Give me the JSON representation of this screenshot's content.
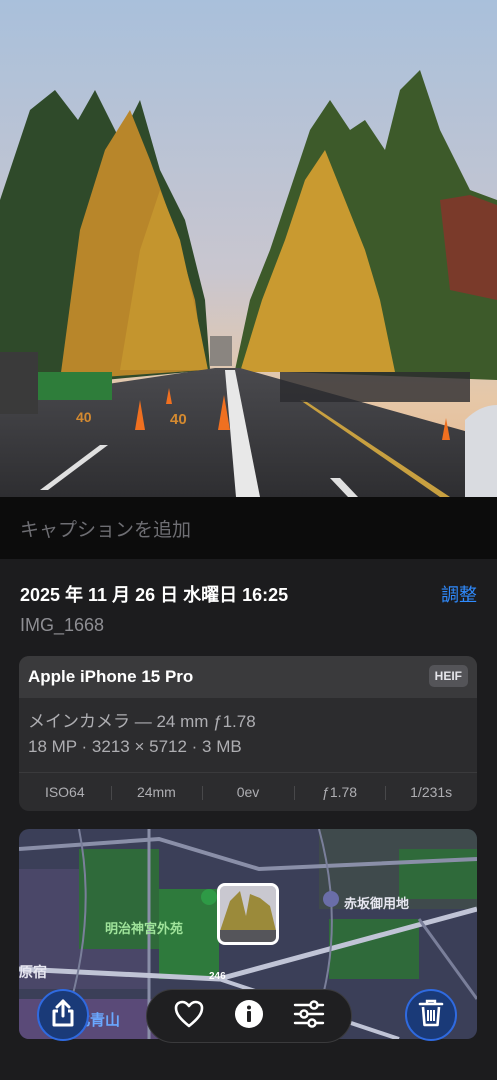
{
  "caption": {
    "placeholder": "キャプションを追加"
  },
  "info": {
    "date": "2025 年 11 月 26 日 水曜日 16:25",
    "adjust_label": "調整",
    "filename": "IMG_1668"
  },
  "camera": {
    "device": "Apple iPhone 15 Pro",
    "format_badge": "HEIF",
    "lens": "メインカメラ — 24 mm ƒ1.78",
    "specs": "18 MP · 3213 × 5712 · 3 MB",
    "exif": [
      "ISO64",
      "24mm",
      "0ev",
      "ƒ1.78",
      "1/231s"
    ]
  },
  "map": {
    "labels": {
      "shrine": "明治神宮外苑",
      "palace": "赤坂御用地",
      "harajuku": "原宿",
      "aoyama": "北青山",
      "road": "246"
    }
  },
  "toolbar": {
    "share_icon": "share-icon",
    "favorite_icon": "heart-icon",
    "info_icon": "info-icon",
    "adjust_icon": "sliders-icon",
    "delete_icon": "trash-icon"
  },
  "colors": {
    "accent": "#2f8bff",
    "panel": "#1c1c1e",
    "card": "#2c2c2e"
  }
}
